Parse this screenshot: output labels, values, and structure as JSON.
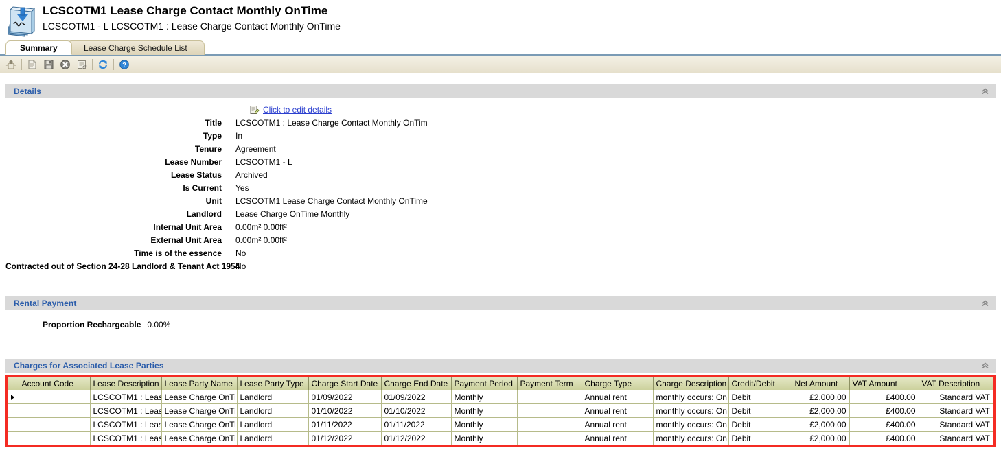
{
  "header": {
    "icon": "lease-document-icon",
    "title": "LCSCOTM1 Lease Charge Contact Monthly OnTime",
    "subtitle": "LCSCOTM1 - L LCSCOTM1 : Lease Charge Contact Monthly OnTime"
  },
  "tabs": [
    {
      "label": "Summary",
      "active": true
    },
    {
      "label": "Lease Charge Schedule List",
      "active": false
    }
  ],
  "toolbar": {
    "buttons": [
      {
        "name": "back-home-icon",
        "glyph": "home"
      },
      {
        "name": "new-document-icon",
        "glyph": "doc"
      },
      {
        "name": "save-icon",
        "glyph": "save"
      },
      {
        "name": "cancel-icon",
        "glyph": "cancel"
      },
      {
        "name": "edit-form-icon",
        "glyph": "form"
      },
      {
        "name": "refresh-icon",
        "glyph": "refresh"
      },
      {
        "name": "help-icon",
        "glyph": "help"
      }
    ]
  },
  "sections": {
    "details": {
      "title": "Details",
      "edit_link": "Click to edit details",
      "fields": [
        {
          "label": "Title",
          "value": "LCSCOTM1 : Lease Charge Contact Monthly OnTim"
        },
        {
          "label": "Type",
          "value": "In"
        },
        {
          "label": "Tenure",
          "value": "Agreement"
        },
        {
          "label": "Lease Number",
          "value": "LCSCOTM1 - L"
        },
        {
          "label": "Lease Status",
          "value": "Archived"
        },
        {
          "label": "Is Current",
          "value": "Yes"
        },
        {
          "label": "Unit",
          "value": "LCSCOTM1 Lease Charge Contact Monthly OnTime"
        },
        {
          "label": "Landlord",
          "value": "Lease Charge OnTime Monthly"
        },
        {
          "label": "Internal Unit Area",
          "value": "0.00m² 0.00ft²"
        },
        {
          "label": "External Unit Area",
          "value": "0.00m² 0.00ft²"
        },
        {
          "label": "Time is of the essence",
          "value": "No"
        },
        {
          "label": "Contracted out of Section 24-28 Landlord & Tenant Act 1954",
          "value": "No"
        }
      ]
    },
    "rental_payment": {
      "title": "Rental Payment",
      "proportion_label": "Proportion Rechargeable",
      "proportion_value": "0.00%"
    },
    "charges": {
      "title": "Charges for Associated Lease Parties",
      "columns": [
        "Account Code",
        "Lease Description",
        "Lease Party Name",
        "Lease Party Type",
        "Charge Start Date",
        "Charge End Date",
        "Payment Period",
        "Payment Term",
        "Charge Type",
        "Charge Description",
        "Credit/Debit",
        "Net Amount",
        "VAT Amount",
        "VAT Description"
      ],
      "rows": [
        {
          "selected": true,
          "account_code": "",
          "lease_description": "LCSCOTM1 : Leas",
          "lease_party_name": "Lease Charge OnTi",
          "lease_party_type": "Landlord",
          "charge_start_date": "01/09/2022",
          "charge_end_date": "01/09/2022",
          "payment_period": "Monthly",
          "payment_term": "",
          "charge_type": "Annual rent",
          "charge_description": "monthly occurs: On t",
          "credit_debit": "Debit",
          "net_amount": "£2,000.00",
          "vat_amount": "£400.00",
          "vat_description": "Standard VAT"
        },
        {
          "selected": false,
          "account_code": "",
          "lease_description": "LCSCOTM1 : Leas",
          "lease_party_name": "Lease Charge OnTi",
          "lease_party_type": "Landlord",
          "charge_start_date": "01/10/2022",
          "charge_end_date": "01/10/2022",
          "payment_period": "Monthly",
          "payment_term": "",
          "charge_type": "Annual rent",
          "charge_description": "monthly occurs: On t",
          "credit_debit": "Debit",
          "net_amount": "£2,000.00",
          "vat_amount": "£400.00",
          "vat_description": "Standard VAT"
        },
        {
          "selected": false,
          "account_code": "",
          "lease_description": "LCSCOTM1 : Leas",
          "lease_party_name": "Lease Charge OnTi",
          "lease_party_type": "Landlord",
          "charge_start_date": "01/11/2022",
          "charge_end_date": "01/11/2022",
          "payment_period": "Monthly",
          "payment_term": "",
          "charge_type": "Annual rent",
          "charge_description": "monthly occurs: On t",
          "credit_debit": "Debit",
          "net_amount": "£2,000.00",
          "vat_amount": "£400.00",
          "vat_description": "Standard VAT"
        },
        {
          "selected": false,
          "account_code": "",
          "lease_description": "LCSCOTM1 : Leas",
          "lease_party_name": "Lease Charge OnTi",
          "lease_party_type": "Landlord",
          "charge_start_date": "01/12/2022",
          "charge_end_date": "01/12/2022",
          "payment_period": "Monthly",
          "payment_term": "",
          "charge_type": "Annual rent",
          "charge_description": "monthly occurs: On t",
          "credit_debit": "Debit",
          "net_amount": "£2,000.00",
          "vat_amount": "£400.00",
          "vat_description": "Standard VAT"
        }
      ]
    }
  },
  "colors": {
    "panel_title": "#2a5caa",
    "panel_header_bg": "#d9d9d9",
    "grid_header_bg": "#ccd19d",
    "highlight_border": "#f42b23",
    "link": "#2b3fcf"
  }
}
